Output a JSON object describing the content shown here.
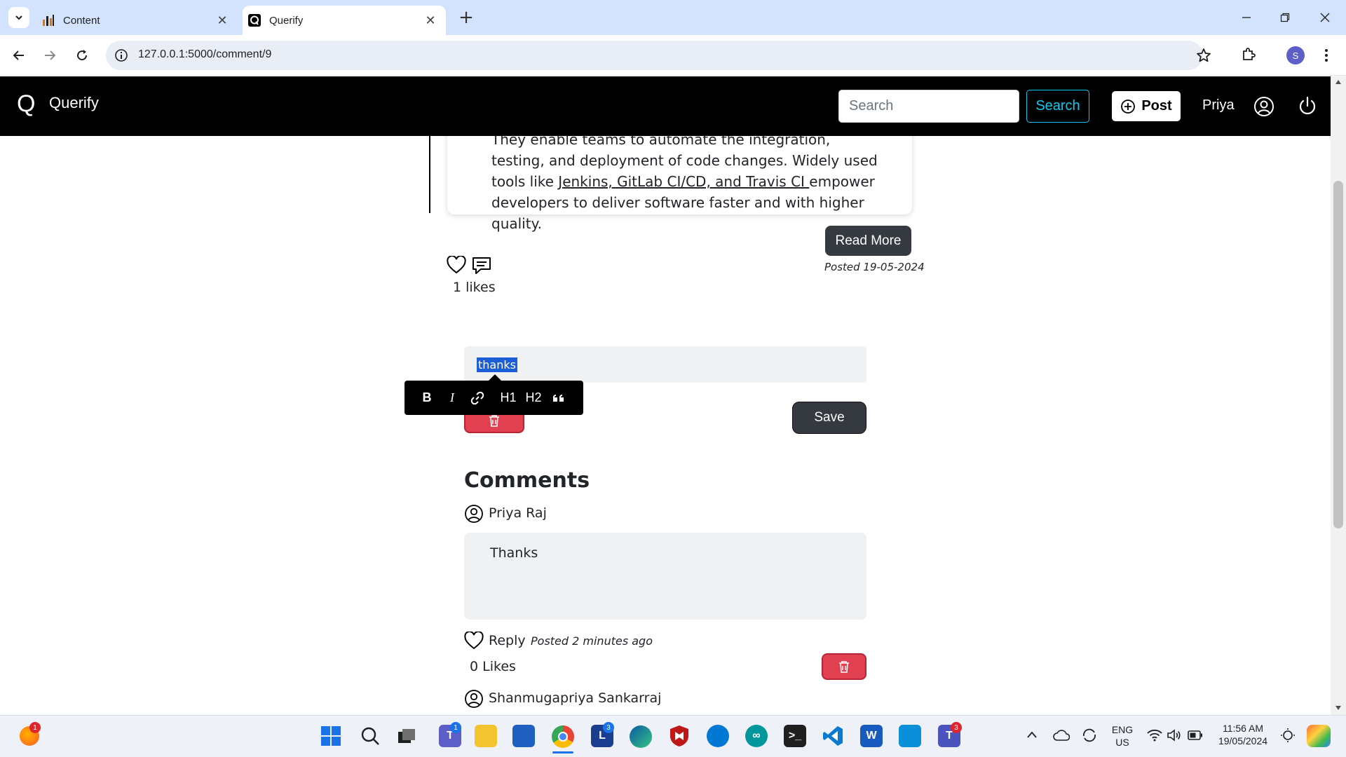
{
  "browser": {
    "tabs": [
      {
        "title": "Content"
      },
      {
        "title": "Querify"
      }
    ],
    "url": "127.0.0.1:5000/comment/9",
    "profile_initial": "S",
    "new_tab_glyph": "+"
  },
  "site": {
    "logo": "Q",
    "brand": "Querify",
    "search_placeholder": "Search",
    "search_button": "Search",
    "post_button": "Post",
    "user": "Priya"
  },
  "post": {
    "body_before_link": "They enable teams to automate the integration, testing, and deployment of code changes. Widely used tools like ",
    "link_text": "Jenkins, GitLab CI/CD, and Travis CI ",
    "body_after_link": "empower developers to deliver software faster and with higher quality.",
    "read_more": "Read More",
    "posted": "Posted 19-05-2024",
    "likes": "1 likes"
  },
  "editor": {
    "text": "thanks",
    "toolbar": [
      "B",
      "I",
      "link",
      "H1",
      "H2",
      "quote"
    ],
    "save_button": "Save"
  },
  "comments": {
    "heading": "Comments",
    "items": [
      {
        "author": "Priya Raj",
        "text": "Thanks",
        "reply": "Reply",
        "posted": "Posted 2 minutes ago",
        "likes": "0 Likes"
      },
      {
        "author": "Shanmugapriya Sankarraj"
      }
    ]
  },
  "taskbar": {
    "lang_line1": "ENG",
    "lang_line2": "US",
    "time": "11:56 AM",
    "date": "19/05/2024",
    "badges": {
      "firefox": "1",
      "teams": "1",
      "l_app": "3",
      "teams_new": "3"
    }
  }
}
